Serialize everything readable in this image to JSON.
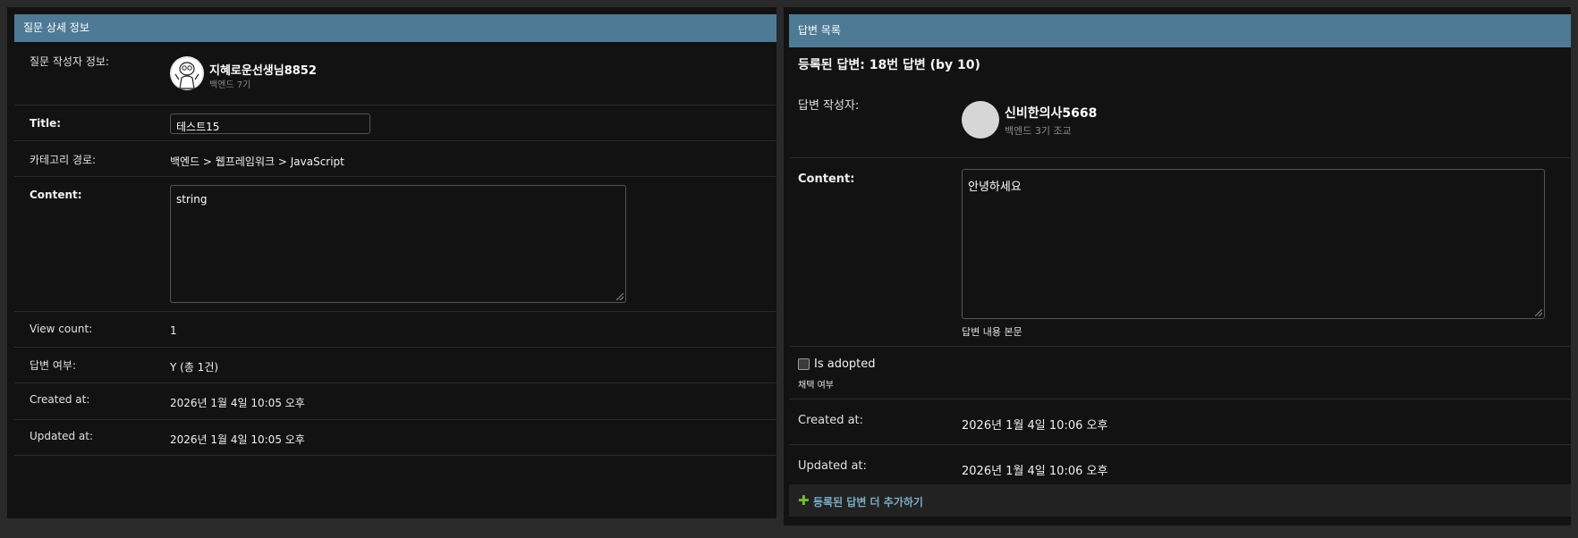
{
  "question": {
    "header": "질문 상세 정보",
    "author_label": "질문 작성자 정보:",
    "author_name": "지혜로운선생님8852",
    "author_sub": "백엔드 7기",
    "title_label": "Title:",
    "title_value": "테스트15",
    "category_label": "카테고리 경로:",
    "category_value": "백엔드 > 웹프레임워크 > JavaScript",
    "content_label": "Content:",
    "content_value": "string",
    "view_label": "View count:",
    "view_value": "1",
    "answer_label": "답변 여부:",
    "answer_value": "Y (총 1건)",
    "created_label": "Created at:",
    "created_value": "2026년 1월 4일 10:05 오후",
    "updated_label": "Updated at:",
    "updated_value": "2026년 1월 4일 10:05 오후"
  },
  "answers": {
    "header": "답변 목록",
    "subtitle": "등록된 답변: 18번 답변 (by 10)",
    "author_label": "답변 작성자:",
    "author_name": "신비한의사5668",
    "author_sub": "백엔드 3기 조교",
    "content_label": "Content:",
    "content_value": "안녕하세요",
    "content_help": "답변 내용 본문",
    "adopted_label": "Is adopted",
    "adopted_checked": false,
    "adopted_help": "채택 여부",
    "created_label": "Created at:",
    "created_value": "2026년 1월 4일 10:06 오후",
    "updated_label": "Updated at:",
    "updated_value": "2026년 1월 4일 10:06 오후",
    "add_link": "등록된 답변 더 추가하기"
  },
  "colors": {
    "header_bg": "#4f7a95",
    "panel_bg": "#121212",
    "link": "#79aec8",
    "add_icon": "#70bf2b"
  },
  "icons": [
    "avatar-cartoon-icon",
    "plus-icon",
    "resize-grip-icon"
  ]
}
